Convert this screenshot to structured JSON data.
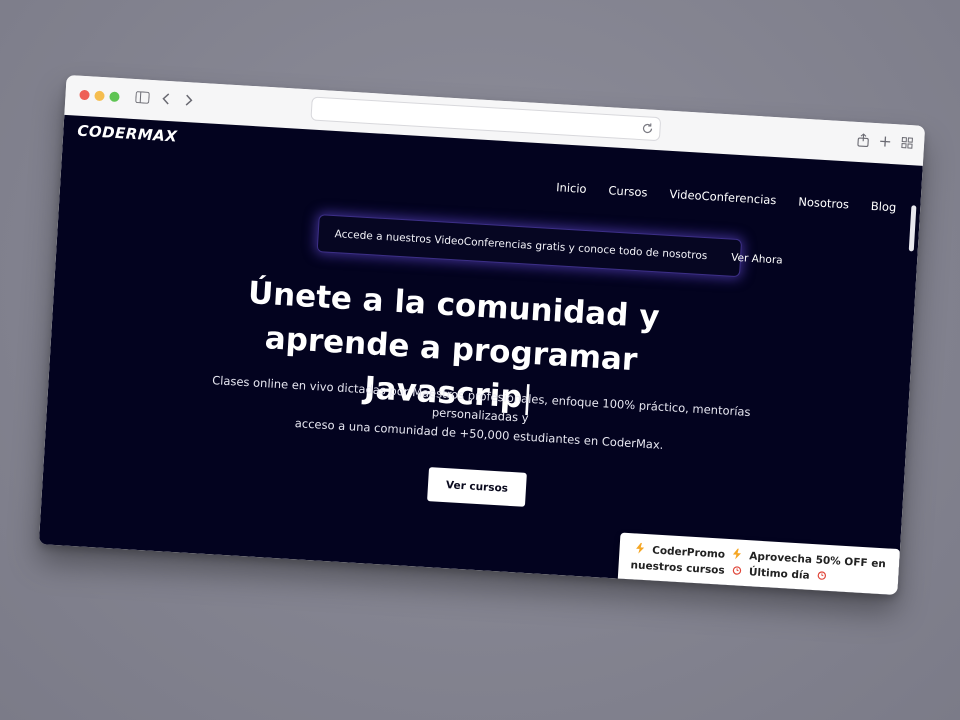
{
  "page": {
    "logo": "CODERMAX",
    "nav": [
      "Inicio",
      "Cursos",
      "VideoConferencias",
      "Nosotros",
      "Blog"
    ],
    "announcement": {
      "message": "Accede a nuestros VideoConferencias gratis y conoce todo de nosotros",
      "cta": "Ver Ahora"
    },
    "hero": {
      "title_line1": "Únete a la comunidad y",
      "title_line2": "aprende a programar Javascrip",
      "caret": "|",
      "subtitle_line1": "Clases online en vivo dictadas por Maestros profesionales, enfoque 100% práctico, mentorías personalizadas y",
      "subtitle_line2": "acceso a una comunidad de +50,000 estudiantes en CoderMax.",
      "button": "Ver cursos"
    },
    "promo": {
      "part1": "CoderPromo",
      "part2": "Aprovecha 50% OFF en nuestros",
      "part3": "cursos",
      "part4": "Último día"
    }
  },
  "colors": {
    "page_bg": "#03031f",
    "glow": "#6c50e6",
    "bolt": "#f5a623",
    "clock": "#e0463a"
  },
  "icons": {
    "chrome": [
      "sidebar-icon",
      "back-icon",
      "forward-icon",
      "reload-icon",
      "share-icon",
      "new-tab-icon",
      "tab-overview-icon"
    ],
    "promo": [
      "lightning-icon",
      "alarm-clock-icon"
    ]
  }
}
